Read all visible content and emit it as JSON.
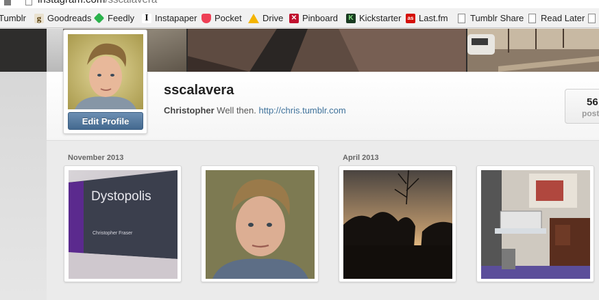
{
  "browser": {
    "url_host": "instagram.com",
    "url_path": "/sscalavera"
  },
  "bookmarks": [
    {
      "label": "Tumblr",
      "icon": "tumblr-icon"
    },
    {
      "label": "Goodreads",
      "icon": "goodreads-icon",
      "glyph": "g"
    },
    {
      "label": "Feedly",
      "icon": "feedly-icon"
    },
    {
      "label": "Instapaper",
      "icon": "instapaper-icon",
      "glyph": "I"
    },
    {
      "label": "Pocket",
      "icon": "pocket-icon"
    },
    {
      "label": "Drive",
      "icon": "drive-icon"
    },
    {
      "label": "Pinboard",
      "icon": "pinboard-icon"
    },
    {
      "label": "Kickstarter",
      "icon": "kickstarter-icon",
      "glyph": "K"
    },
    {
      "label": "Last.fm",
      "icon": "lastfm-icon",
      "glyph": "as"
    },
    {
      "label": "Tumblr Share",
      "icon": "page-icon"
    },
    {
      "label": "Read Later",
      "icon": "page-icon"
    }
  ],
  "profile": {
    "username": "sscalavera",
    "full_name": "Christopher",
    "bio": "Well then.",
    "link": "http://chris.tumblr.com",
    "edit_button": "Edit Profile",
    "posts_count": "56",
    "posts_label": "posts"
  },
  "feed": {
    "months": [
      "November 2013",
      "April 2013"
    ],
    "photos": [
      {
        "name": "photo-dystopolis-slide",
        "slide_title": "Dystopolis",
        "slide_author": "Christopher Fraser"
      },
      {
        "name": "photo-selfie"
      },
      {
        "name": "photo-sunset-trees"
      },
      {
        "name": "photo-room-keyboard"
      }
    ]
  },
  "colors": {
    "link_blue": "#3f729b",
    "button_blue": "#517fa4",
    "header_dark": "#2e2d2c"
  }
}
